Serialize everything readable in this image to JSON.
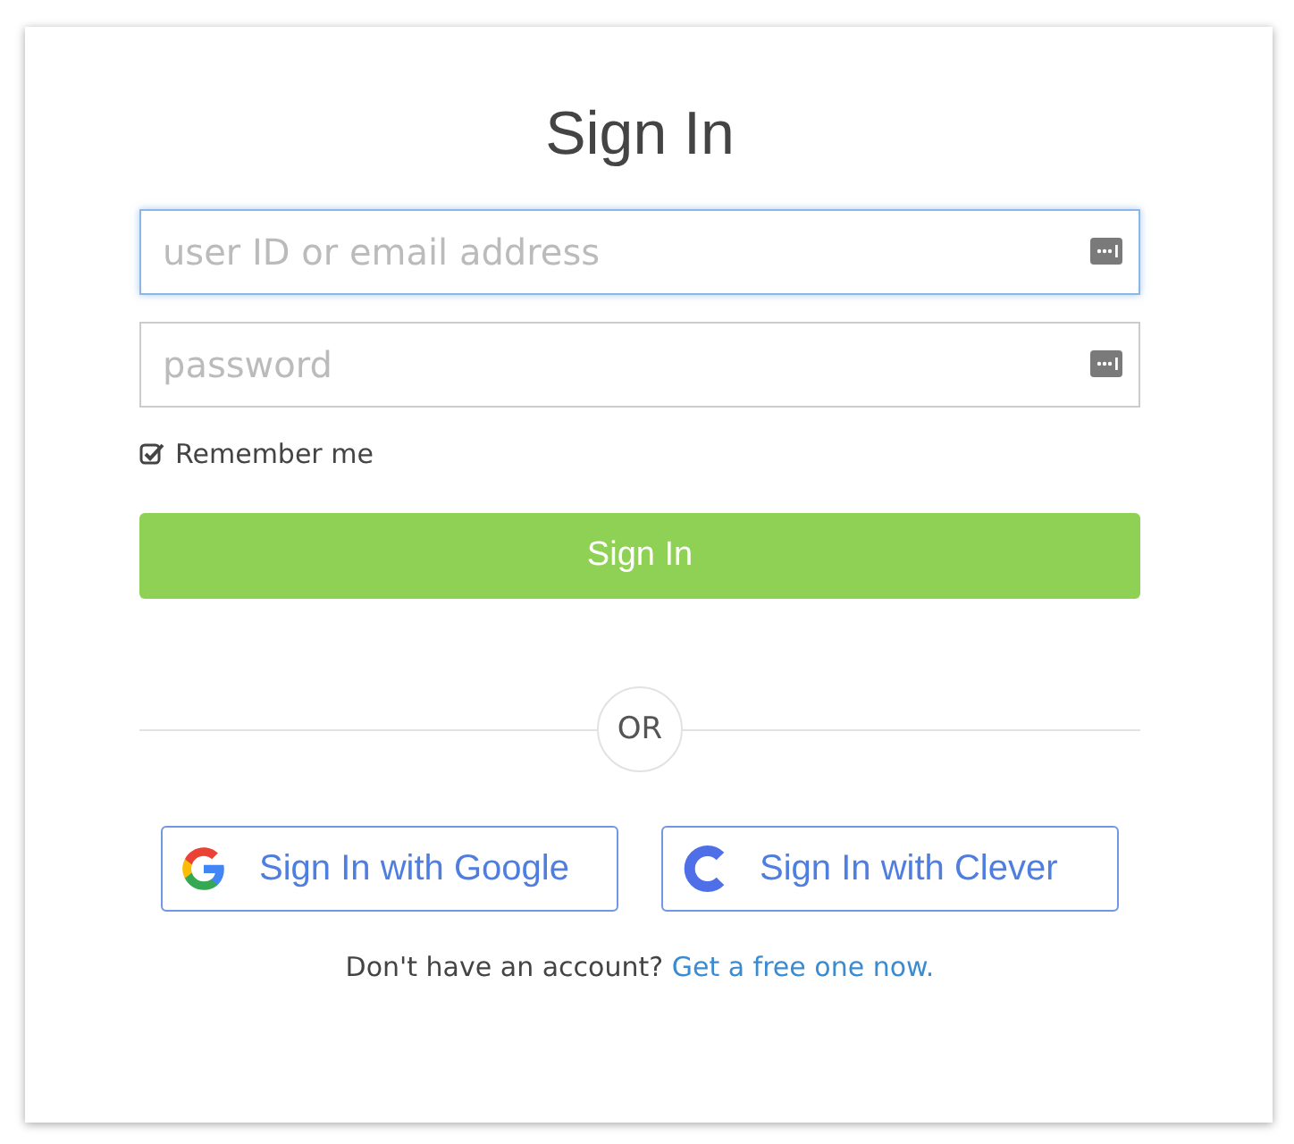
{
  "title": "Sign In",
  "fields": [
    {
      "placeholder": "user ID or email address",
      "focused": true
    },
    {
      "placeholder": "password",
      "focused": false
    }
  ],
  "remember": {
    "label": "Remember me",
    "checked": true
  },
  "submit": "Sign In",
  "divider": "OR",
  "social": [
    {
      "kind": "google",
      "label": "Sign In with Google"
    },
    {
      "kind": "clever",
      "label": "Sign In with Clever"
    }
  ],
  "footer": {
    "text": "Don't have an account?",
    "link": "Get a free one now."
  }
}
